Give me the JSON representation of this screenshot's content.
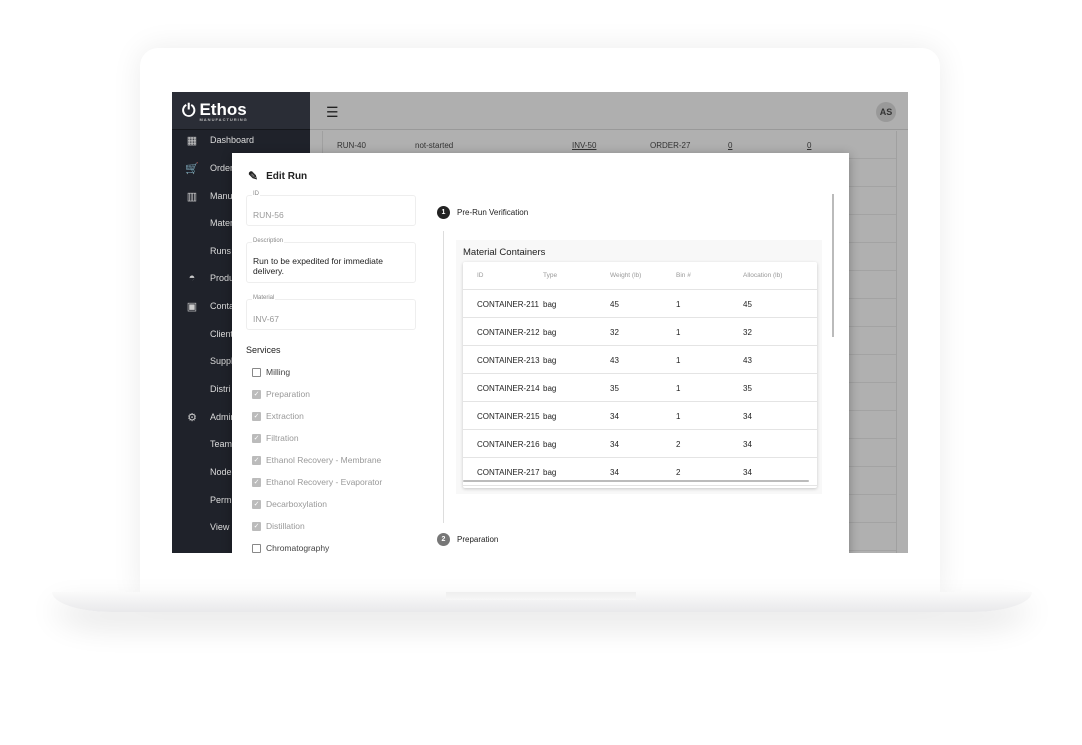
{
  "app": {
    "brand": "Ethos",
    "brand_sub": "MANUFACTURING",
    "user_initials": "AS"
  },
  "sidebar": {
    "items": [
      {
        "label": "Dashboard",
        "icon": "dashboard-icon"
      },
      {
        "label": "Orders",
        "icon": "cart-icon"
      },
      {
        "label": "Manuf",
        "icon": "building-icon"
      },
      {
        "label": "Mater",
        "icon": ""
      },
      {
        "label": "Runs",
        "icon": ""
      },
      {
        "label": "Produ",
        "icon": "drop-icon"
      },
      {
        "label": "Conta",
        "icon": "contact-icon"
      },
      {
        "label": "Client",
        "icon": ""
      },
      {
        "label": "Suppl",
        "icon": ""
      },
      {
        "label": "Distri",
        "icon": ""
      },
      {
        "label": "Admin",
        "icon": "gear-icon"
      },
      {
        "label": "Team",
        "icon": ""
      },
      {
        "label": "Node",
        "icon": ""
      },
      {
        "label": "Permi",
        "icon": ""
      },
      {
        "label": "View",
        "icon": ""
      }
    ]
  },
  "background_table": {
    "rows": [
      [
        "RUN-40",
        "not-started",
        "INV-50",
        "ORDER-27",
        "0",
        "0"
      ]
    ]
  },
  "modal": {
    "title": "Edit Run",
    "id_label": "ID",
    "id_value": "RUN-56",
    "description_label": "Description",
    "description_value": "Run to be expedited for immediate delivery.",
    "material_label": "Material",
    "material_value": "INV-67",
    "services_label": "Services",
    "services": [
      {
        "label": "Milling",
        "checked": false
      },
      {
        "label": "Preparation",
        "checked": true
      },
      {
        "label": "Extraction",
        "checked": true
      },
      {
        "label": "Filtration",
        "checked": true
      },
      {
        "label": "Ethanol Recovery - Membrane",
        "checked": true
      },
      {
        "label": "Ethanol Recovery - Evaporator",
        "checked": true
      },
      {
        "label": "Decarboxylation",
        "checked": true
      },
      {
        "label": "Distillation",
        "checked": true
      },
      {
        "label": "Chromatography",
        "checked": false
      }
    ],
    "steps": [
      {
        "num": "1",
        "label": "Pre-Run Verification"
      },
      {
        "num": "2",
        "label": "Preparation"
      }
    ],
    "containers": {
      "title": "Material Containers",
      "columns": [
        "ID",
        "Type",
        "Weight (lb)",
        "Bin #",
        "Allocation (lb)"
      ],
      "rows": [
        [
          "CONTAINER-211",
          "bag",
          "45",
          "1",
          "45"
        ],
        [
          "CONTAINER-212",
          "bag",
          "32",
          "1",
          "32"
        ],
        [
          "CONTAINER-213",
          "bag",
          "43",
          "1",
          "43"
        ],
        [
          "CONTAINER-214",
          "bag",
          "35",
          "1",
          "35"
        ],
        [
          "CONTAINER-215",
          "bag",
          "34",
          "1",
          "34"
        ],
        [
          "CONTAINER-216",
          "bag",
          "34",
          "2",
          "34"
        ],
        [
          "CONTAINER-217",
          "bag",
          "34",
          "2",
          "34"
        ]
      ]
    }
  }
}
